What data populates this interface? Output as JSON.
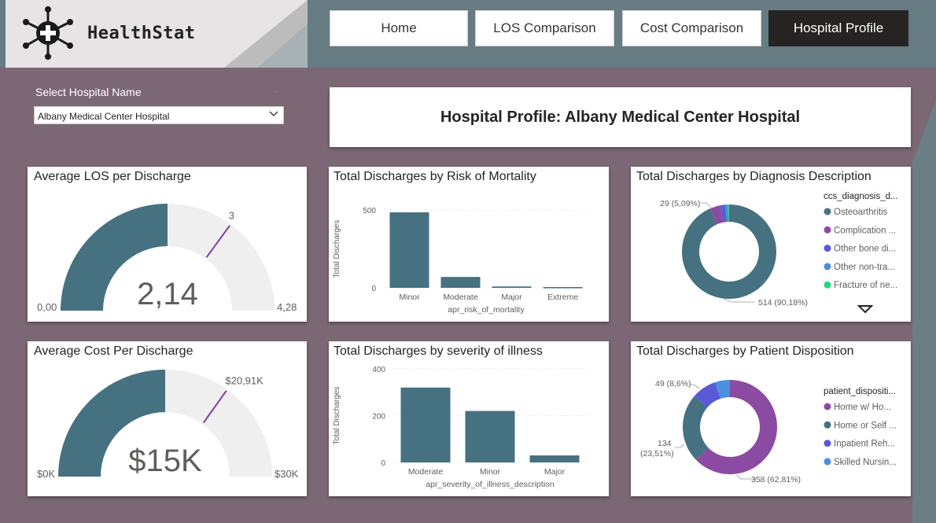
{
  "app": {
    "brand": "HealthStat",
    "nav": [
      {
        "label": "Home",
        "active": false
      },
      {
        "label": "LOS Comparison",
        "active": false
      },
      {
        "label": "Cost Comparison",
        "active": false
      },
      {
        "label": "Hospital Profile",
        "active": true
      }
    ]
  },
  "slicer": {
    "label": "Select Hospital Name",
    "selected": "Albany Medical Center Hospital"
  },
  "page_title": "Hospital Profile: Albany Medical Center Hospital",
  "colors": {
    "teal": "#467180",
    "purple": "#8c4ba3",
    "blue": "#5a5ad6",
    "light_blue": "#4a8fe0",
    "green": "#1fd97a",
    "gauge_track": "#f0efef",
    "target": "#7b3fa0"
  },
  "chart_data": [
    {
      "type": "gauge",
      "title": "Average LOS per Discharge",
      "value": 2.14,
      "value_label": "2,14",
      "min": 0,
      "max": 4.28,
      "min_label": "0,00",
      "max_label": "4,28",
      "target": 3,
      "target_label": "3"
    },
    {
      "type": "bar",
      "title": "Total Discharges by Risk of Mortality",
      "categories": [
        "Minor",
        "Moderate",
        "Major",
        "Extreme"
      ],
      "values": [
        485,
        70,
        9,
        5
      ],
      "xlabel": "apr_risk_of_mortality",
      "ylabel": "Total Discharges",
      "ylim": [
        0,
        500
      ],
      "yticks": [
        0,
        500
      ],
      "grid": true
    },
    {
      "type": "pie",
      "title": "Total Discharges by Diagnosis Description",
      "donut": true,
      "legend_title": "ccs_diagnosis_d...",
      "legend_position": "right",
      "slices": [
        {
          "name": "Osteoarthritis",
          "value": 514,
          "color": "#467180"
        },
        {
          "name": "Complication ...",
          "value": 19,
          "color": "#8c4ba3"
        },
        {
          "name": "Other bone di...",
          "value": 10,
          "color": "#5a5ad6"
        },
        {
          "name": "Other non-tra...",
          "value": 5,
          "color": "#4a8fe0"
        },
        {
          "name": "Fracture of ne...",
          "value": 2,
          "color": "#1fd97a"
        }
      ],
      "data_labels": [
        "514 (90,18%)",
        "29 (5,09%)"
      ]
    },
    {
      "type": "gauge",
      "title": "Average Cost Per Discharge",
      "value": 15000,
      "value_label": "$15K",
      "min": 0,
      "max": 30000,
      "min_label": "$0K",
      "max_label": "$30K",
      "target": 20910,
      "target_label": "$20,91K"
    },
    {
      "type": "bar",
      "title": "Total Discharges by severity of illness",
      "categories": [
        "Moderate",
        "Minor",
        "Major"
      ],
      "values": [
        320,
        220,
        30
      ],
      "xlabel": "apr_severity_of_illness_description",
      "ylabel": "Total Discharges",
      "ylim": [
        0,
        400
      ],
      "yticks": [
        0,
        200,
        400
      ],
      "grid": true
    },
    {
      "type": "pie",
      "title": "Total Discharges by Patient Disposition",
      "donut": true,
      "legend_title": "patient_dispositi...",
      "legend_position": "right",
      "slices": [
        {
          "name": "Home w/ Ho...",
          "value": 358,
          "color": "#8c4ba3"
        },
        {
          "name": "Home or Self ...",
          "value": 134,
          "color": "#467180"
        },
        {
          "name": "Inpatient Reh...",
          "value": 49,
          "color": "#5a5ad6"
        },
        {
          "name": "Skilled Nursin...",
          "value": 29,
          "color": "#4a8fe0"
        }
      ],
      "data_labels": [
        "358 (62,81%)",
        "134",
        "(23,51%)",
        "49 (8,6%)"
      ]
    }
  ]
}
